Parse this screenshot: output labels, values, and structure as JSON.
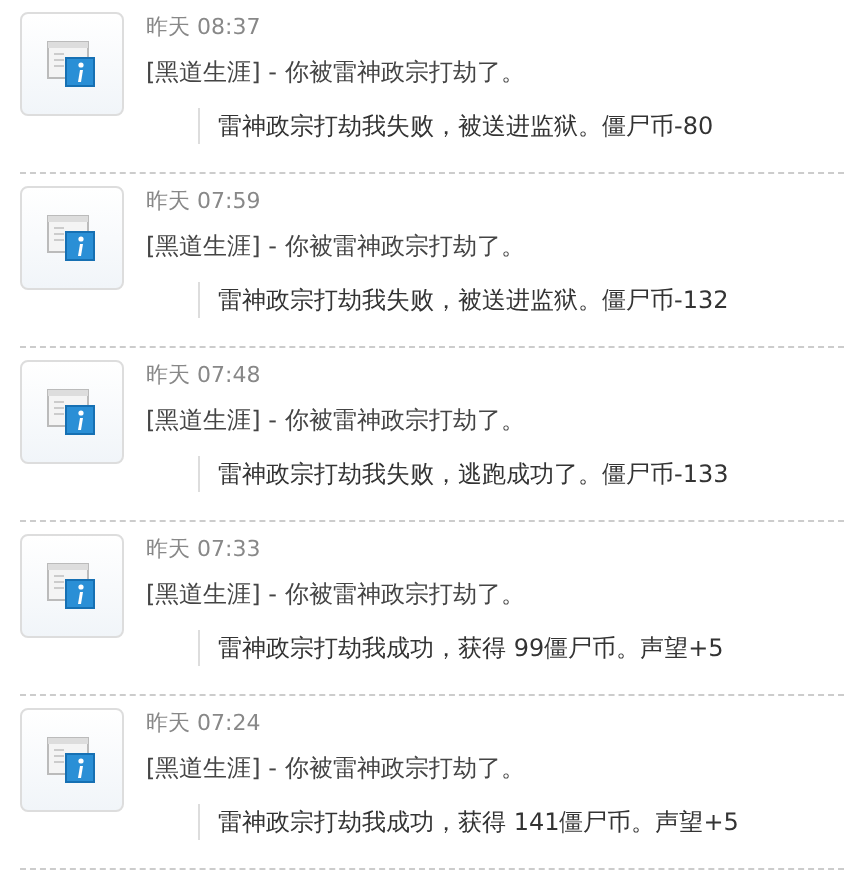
{
  "entries": [
    {
      "time": "昨天 08:37",
      "title": "[黑道生涯] - 你被雷神政宗打劫了。",
      "detail": "雷神政宗打劫我失败，被送进监狱。僵尸币-80"
    },
    {
      "time": "昨天 07:59",
      "title": "[黑道生涯] - 你被雷神政宗打劫了。",
      "detail": "雷神政宗打劫我失败，被送进监狱。僵尸币-132"
    },
    {
      "time": "昨天 07:48",
      "title": "[黑道生涯] - 你被雷神政宗打劫了。",
      "detail": "雷神政宗打劫我失败，逃跑成功了。僵尸币-133"
    },
    {
      "time": "昨天 07:33",
      "title": "[黑道生涯] - 你被雷神政宗打劫了。",
      "detail": "雷神政宗打劫我成功，获得 99僵尸币。声望+5"
    },
    {
      "time": "昨天 07:24",
      "title": "[黑道生涯] - 你被雷神政宗打劫了。",
      "detail": "雷神政宗打劫我成功，获得 141僵尸币。声望+5"
    }
  ]
}
